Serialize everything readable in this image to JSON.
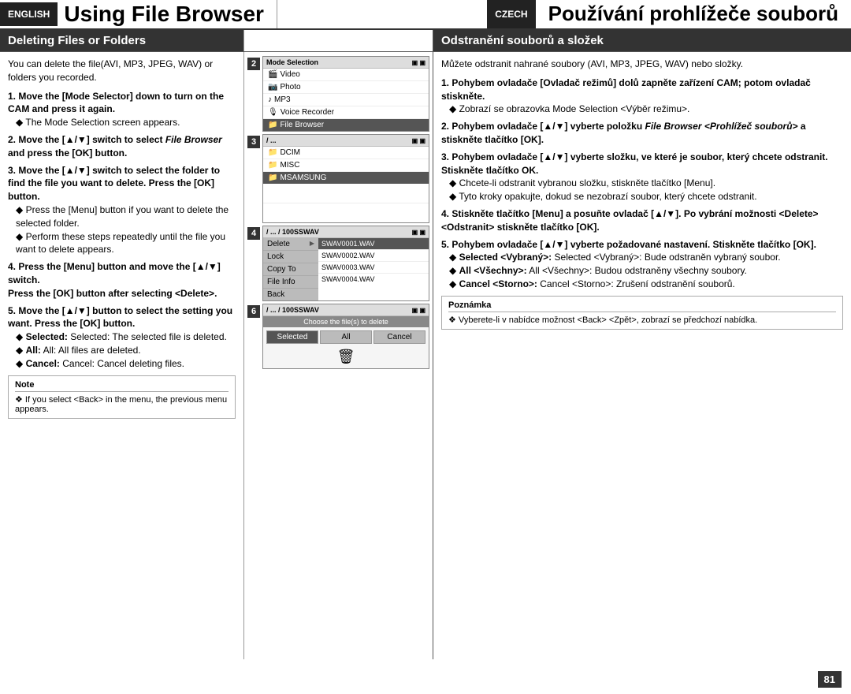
{
  "header": {
    "lang_en": "ENGLISH",
    "lang_cz": "CZECH",
    "title_en": "Using File Browser",
    "title_cz": "Používání prohlížeče souborů"
  },
  "sections": {
    "en_heading": "Deleting Files or Folders",
    "cz_heading": "Odstranění souborů a složek"
  },
  "en": {
    "intro": "You can delete the file(AVI, MP3, JPEG, WAV) or folders you recorded.",
    "steps": [
      {
        "num": "1.",
        "main": "Move the [Mode Selector] down to turn on the CAM and press it again.",
        "bullets": [
          "The Mode Selection screen appears."
        ]
      },
      {
        "num": "2.",
        "main": "Move the [▲/▼] switch to select File Browser and press the [OK] button."
      },
      {
        "num": "3.",
        "main": "Move the [▲/▼] switch to select the folder to find the file you want to delete. Press the [OK] button.",
        "bullets": [
          "Press the [Menu] button if you want to delete the selected folder.",
          "Perform these steps repeatedly until the file you want to delete appears."
        ]
      },
      {
        "num": "4.",
        "main": "Press the [Menu] button and move the [▲/▼] switch. Press the [OK] button after selecting <Delete>."
      },
      {
        "num": "5.",
        "main": "Move the [▲/▼] button to select the setting you want. Press the [OK] button.",
        "bullets": [
          "Selected: The selected file is deleted.",
          "All: All files are deleted.",
          "Cancel: Cancel deleting files."
        ]
      }
    ],
    "note_title": "Note",
    "note_text": "If you select <Back> in the menu, the previous menu appears."
  },
  "cz": {
    "intro": "Můžete odstranit nahrané soubory (AVI, MP3, JPEG, WAV) nebo složky.",
    "steps": [
      {
        "num": "1.",
        "main": "Pohybem ovladače [Ovladač režimů] dolů zapněte zařízení CAM; potom ovladač stiskněte.",
        "bullets": [
          "Zobrazí se obrazovka Mode Selection <Výběr režimu>."
        ]
      },
      {
        "num": "2.",
        "main": "Pohybem ovladače [▲/▼] vyberte položku File Browser <Prohlížeč souborů> a stiskněte tlačítko [OK]."
      },
      {
        "num": "3.",
        "main": "Pohybem ovladače [▲/▼] vyberte složku, ve které je soubor, který chcete odstranit. Stiskněte tlačítko OK.",
        "bullets": [
          "Chcete-li odstranit vybranou složku, stiskněte tlačítko [Menu].",
          "Tyto kroky opakujte, dokud se nezobrazí soubor, který chcete odstranit."
        ]
      },
      {
        "num": "4.",
        "main": "Stiskněte tlačítko [Menu] a posuňte ovladač [▲/▼]. Po vybrání možnosti <Delete> <Odstranit> stiskněte tlačítko [OK]."
      },
      {
        "num": "5.",
        "main": "Pohybem ovladače [▲/▼] vyberte požadované nastavení. Stiskněte tlačítko [OK].",
        "bullets": [
          "Selected <Vybraný>: Bude odstraněn vybraný soubor.",
          "All <Všechny>: Budou odstraněny všechny soubory.",
          "Cancel <Storno>: Zrušení odstranění souborů."
        ]
      }
    ],
    "note_title": "Poznámka",
    "note_text": "Vyberete-li v nabídce možnost <Back> <Zpět>, zobrazí se předchozí nabídka."
  },
  "screens": {
    "screen2": {
      "title": "Mode Selection",
      "items": [
        "Video",
        "Photo",
        "MP3",
        "Voice Recorder",
        "File Browser"
      ]
    },
    "screen3": {
      "title": "/ ...",
      "items": [
        "DCIM",
        "MISC",
        "MSAMSUNG"
      ]
    },
    "screen4": {
      "title": "/ ... / 100SSWAV",
      "menu_items": [
        "Delete",
        "Lock",
        "Copy To",
        "File Info",
        "Back"
      ],
      "files": [
        "SWAV0001.WAV",
        "SWAV0002.WAV",
        "SWAV0003.WAV",
        "SWAV0004.WAV"
      ]
    },
    "screen6": {
      "title": "/ ... / 100SSWAV",
      "choose_text": "Choose the file(s) to delete",
      "options": [
        "Selected",
        "All",
        "Cancel"
      ]
    }
  },
  "page_number": "81"
}
